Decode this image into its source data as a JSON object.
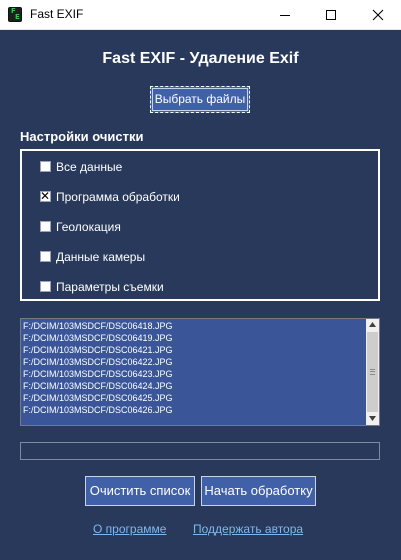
{
  "window": {
    "title": "Fast EXIF",
    "icon": "fast-exif-app-icon",
    "icon_letters": [
      "F",
      "E"
    ]
  },
  "header": {
    "title": "Fast EXIF - Удаление Exif"
  },
  "select_button": {
    "label": "Выбрать файлы"
  },
  "settings": {
    "label": "Настройки очистки",
    "options": [
      {
        "label": "Все данные",
        "checked": false
      },
      {
        "label": "Программа обработки",
        "checked": true
      },
      {
        "label": "Геолокация",
        "checked": false
      },
      {
        "label": "Данные камеры",
        "checked": false
      },
      {
        "label": "Параметры съемки",
        "checked": false
      }
    ]
  },
  "file_list": {
    "items": [
      "F:/DCIM/103MSDCF/DSC06418.JPG",
      "F:/DCIM/103MSDCF/DSC06419.JPG",
      "F:/DCIM/103MSDCF/DSC06421.JPG",
      "F:/DCIM/103MSDCF/DSC06422.JPG",
      "F:/DCIM/103MSDCF/DSC06423.JPG",
      "F:/DCIM/103MSDCF/DSC06424.JPG",
      "F:/DCIM/103MSDCF/DSC06425.JPG",
      "F:/DCIM/103MSDCF/DSC06426.JPG"
    ]
  },
  "progress": {
    "value": 0
  },
  "actions": {
    "clear_label": "Очистить список",
    "start_label": "Начать обработку"
  },
  "links": {
    "about": "О программе",
    "support": "Поддержать автора"
  },
  "colors": {
    "background": "#28395b",
    "button": "#4060a8",
    "list_selection": "#3a5598",
    "link": "#7fb8ee"
  }
}
